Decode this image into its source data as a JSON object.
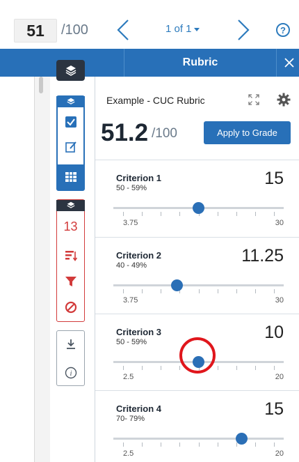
{
  "header": {
    "grade_value": "51",
    "grade_total": "/100",
    "page_indicator": "1 of 1",
    "help_glyph": "?"
  },
  "panel": {
    "tab_title": "Rubric",
    "rubric_name": "Example - CUC Rubric",
    "total_score": "51.2",
    "total_max": "/100",
    "apply_label": "Apply to Grade"
  },
  "toolbar": {
    "flag_count": "13",
    "info_glyph": "i"
  },
  "criteria": [
    {
      "name": "Criterion 1",
      "band": "50 - 59%",
      "score": "15",
      "min": "3.75",
      "max": "30",
      "level": 0.5,
      "ticks": 9
    },
    {
      "name": "Criterion 2",
      "band": "40 - 49%",
      "score": "11.25",
      "min": "3.75",
      "max": "30",
      "level": 0.357,
      "ticks": 9
    },
    {
      "name": "Criterion 3",
      "band": "50 - 59%",
      "score": "10",
      "min": "2.5",
      "max": "20",
      "level": 0.5,
      "ticks": 9
    },
    {
      "name": "Criterion 4",
      "band": "70- 79%",
      "score": "15",
      "min": "2.5",
      "max": "20",
      "level": 0.786,
      "ticks": 9
    }
  ],
  "colors": {
    "accent": "#2870b8",
    "alert": "#d23a3a",
    "dark": "#2b3441"
  }
}
